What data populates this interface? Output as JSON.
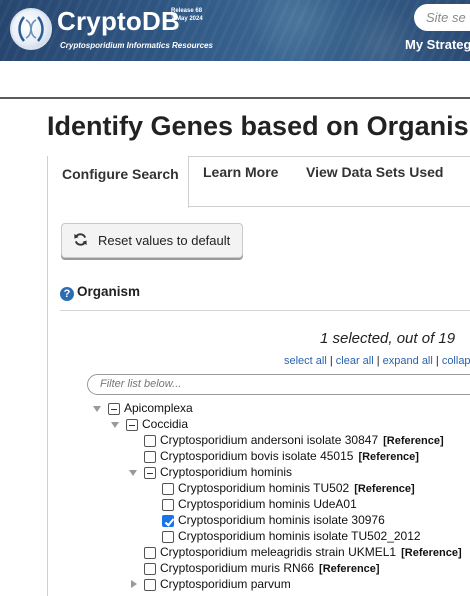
{
  "header": {
    "brand": "CryptoDB",
    "release_line1": "Release 68",
    "release_line2": "7 May 2024",
    "tagline": "Cryptosporidium Informatics Resources",
    "site_search_placeholder": "Site se",
    "my_strategies": "My Strateg"
  },
  "page_title": "Identify Genes based on Organism",
  "tabs": [
    {
      "label": "Configure Search",
      "active": true
    },
    {
      "label": "Learn More",
      "active": false
    },
    {
      "label": "View Data Sets Used",
      "active": false
    }
  ],
  "reset_button_label": "Reset values to default",
  "organism": {
    "heading": "Organism",
    "help_glyph": "?",
    "selected_count_text": "1 selected, out of 19",
    "links": [
      "select all",
      "clear all",
      "expand all",
      "collaps"
    ],
    "filter_placeholder": "Filter list below...",
    "tree": [
      {
        "label": "Apicomplexa",
        "ref": "",
        "expander": "down",
        "state": "partial"
      },
      {
        "label": "Coccidia",
        "ref": "",
        "expander": "down",
        "state": "partial"
      },
      {
        "label": "Cryptosporidium andersoni isolate 30847",
        "ref": "[Reference]",
        "expander": "",
        "state": "unchecked"
      },
      {
        "label": "Cryptosporidium bovis isolate 45015",
        "ref": "[Reference]",
        "expander": "",
        "state": "unchecked"
      },
      {
        "label": "Cryptosporidium hominis",
        "ref": "",
        "expander": "down",
        "state": "partial"
      },
      {
        "label": "Cryptosporidium hominis TU502",
        "ref": "[Reference]",
        "expander": "",
        "state": "unchecked"
      },
      {
        "label": "Cryptosporidium hominis UdeA01",
        "ref": "",
        "expander": "",
        "state": "unchecked"
      },
      {
        "label": "Cryptosporidium hominis isolate 30976",
        "ref": "",
        "expander": "",
        "state": "checked"
      },
      {
        "label": "Cryptosporidium hominis isolate TU502_2012",
        "ref": "",
        "expander": "",
        "state": "unchecked"
      },
      {
        "label": "Cryptosporidium meleagridis strain UKMEL1",
        "ref": "[Reference]",
        "expander": "",
        "state": "unchecked"
      },
      {
        "label": "Cryptosporidium muris RN66",
        "ref": "[Reference]",
        "expander": "",
        "state": "unchecked"
      },
      {
        "label": "Cryptosporidium parvum",
        "ref": "",
        "expander": "right",
        "state": "unchecked"
      }
    ]
  },
  "colors": {
    "banner": "#2f5682",
    "link": "#2a63ad",
    "checkbox_checked": "#1a73e8",
    "help_icon": "#2a6db3"
  }
}
